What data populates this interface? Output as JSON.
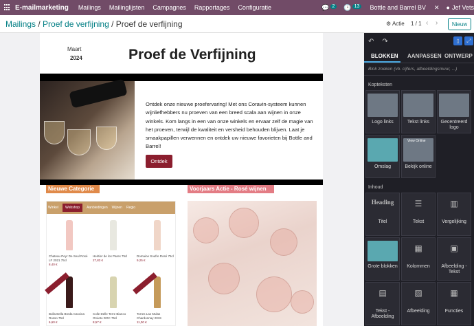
{
  "topbar": {
    "app_name": "E-mailmarketing",
    "menu": [
      "Mailings",
      "Mailinglijsten",
      "Campagnes",
      "Rapportages",
      "Configuratie"
    ],
    "chat_count": "2",
    "activity_count": "13",
    "company": "Bottle and Barrel BV",
    "user": "Jef Vets"
  },
  "breadcrumb": {
    "root": "Mailings",
    "parent": "Proef de verfijning",
    "current": "Proef de verfijning"
  },
  "controls": {
    "actie_label": "Actie",
    "pager": "1 / 1",
    "new_button": "Nieuw"
  },
  "mail": {
    "month": "Maart",
    "year": "2024",
    "title": "Proef de Verfijning",
    "body": "Ontdek onze nieuwe proefervaring! Met ons Coravin-systeem kunnen wijnliefhebbers nu proeven van een breed scala aan wijnen in onze winkels. Kom langs in een van onze winkels en ervaar zelf de magie van het proeven, terwijl de kwaliteit en versheid behouden blijven. Laat je smaakpapillen verwennen en ontdek uw nieuwe favorieten bij Bottle and Barrel!",
    "cta": "Ontdek",
    "label_left": "Nieuwe Categorie",
    "label_right": "Voorjaars Actie - Rosé wijnen",
    "shop_nav": [
      "Winkel",
      "Webshop",
      "Aanbiedingen",
      "Wijnen",
      "Regio"
    ],
    "products": [
      {
        "name": "Chateau Peyr De Seul Rosé LF 2021 75cl",
        "price": "8,40 €"
      },
      {
        "name": "Heritier de los Pares 75cl",
        "price": "27,83 €"
      },
      {
        "name": "Domaine Soufre Rosé 75cl",
        "price": "9,25 €"
      },
      {
        "name": "Bolla Bella Breda Cascina Rosso 75cl",
        "price": "6,60 €"
      },
      {
        "name": "Colle Delle Terre Bianco Orvieto DOC 75cl",
        "price": "8,57 €"
      },
      {
        "name": "Torres Las Mulas Chardonnay 2019",
        "price": "11,00 €"
      }
    ]
  },
  "panel": {
    "undo_icon": "undo-icon",
    "redo_icon": "redo-icon",
    "tabs": [
      "BLOKKEN",
      "AANPASSEN",
      "ONTWERP"
    ],
    "search_placeholder": "Blok zoeken (vb. cijfers, afbeeldingsmuur, ...)",
    "section_headers": "Kopteksten",
    "header_tiles": [
      "Logo links",
      "Tekst links",
      "Gecentreerd logo",
      "Omslag",
      "Bekijk online"
    ],
    "section_content": "Inhoud",
    "content_tiles": [
      "Titel",
      "Tekst",
      "Vergelijking",
      "Grote blokken",
      "Kolommen",
      "Afbeelding - Tekst",
      "Tekst - Afbeelding",
      "Afbeelding",
      "Functies"
    ],
    "heading_sample": "Heading",
    "view_online_sample": "View Online",
    "accent": "#4aa8e0"
  },
  "colors": {
    "brand": "#714b67",
    "teal": "#017e84",
    "cta": "#8b1e2e"
  }
}
